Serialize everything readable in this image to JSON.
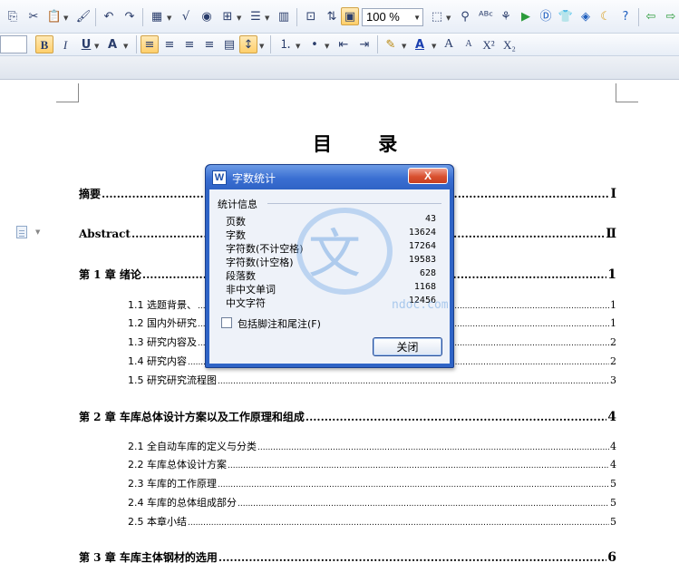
{
  "toolbar": {
    "zoom_value": "100 %",
    "row1_icons": [
      "copy-icon",
      "cut-icon",
      "paste-icon",
      "format-painter-icon",
      "undo-icon",
      "redo-icon",
      "table-icon",
      "formula-icon",
      "web-icon",
      "grid-icon",
      "columns-icon",
      "chart-icon",
      "insert-icon",
      "swap-icon",
      "page-view-icon",
      "select-icon",
      "find-icon",
      "spellcheck-icon",
      "share-icon",
      "play-icon",
      "d-icon",
      "shirt-icon",
      "chat-icon",
      "moon-icon",
      "help-icon",
      "back-icon",
      "forward-icon"
    ],
    "row2": {
      "bold": "B",
      "italic": "I",
      "underline": "U",
      "font_color_a": "A",
      "grow_font": "A",
      "shrink_font": "A",
      "superscript": "X²",
      "subscript": "X₂"
    }
  },
  "document": {
    "title": "目  录",
    "chapters": [
      {
        "label": "摘要",
        "page": "Ⅰ",
        "top": 0
      },
      {
        "label": "Abstract",
        "page": "Ⅱ"
      },
      {
        "label": "第 1 章  绪论",
        "page": "1"
      },
      {
        "label": "第 2 章  车库总体设计方案以及工作原理和组成",
        "page": "4"
      },
      {
        "label": "第 3 章  车库主体钢材的选用",
        "page": "6"
      }
    ],
    "sections": [
      {
        "label": "1.1  选题背景、",
        "page": "1"
      },
      {
        "label": "1.2  国内外研究",
        "page": "1"
      },
      {
        "label": "1.3  研究内容及",
        "page": "2"
      },
      {
        "label": "1.4  研究内容",
        "page": "2"
      },
      {
        "label": "1.5  研究研究流程图",
        "page": "3"
      },
      {
        "label": "2.1  全自动车库的定义与分类",
        "page": "4"
      },
      {
        "label": "2.2  车库总体设计方案",
        "page": "4"
      },
      {
        "label": "2.3  车库的工作原理",
        "page": "5"
      },
      {
        "label": "2.4  车库的总体组成部分",
        "page": "5"
      },
      {
        "label": "2.5  本章小结",
        "page": "5"
      }
    ]
  },
  "dialog": {
    "title": "字数统计",
    "close_glyph": "X",
    "group_label": "统计信息",
    "stats": [
      {
        "label": "页数",
        "value": "43"
      },
      {
        "label": "字数",
        "value": "13624"
      },
      {
        "label": "字符数(不计空格)",
        "value": "17264"
      },
      {
        "label": "字符数(计空格)",
        "value": "19583"
      },
      {
        "label": "段落数",
        "value": "628"
      },
      {
        "label": "非中文单词",
        "value": "1168"
      },
      {
        "label": "中文字符",
        "value": "12456"
      }
    ],
    "checkbox_label": "包括脚注和尾注(F)",
    "checkbox_checked": false,
    "ok_label": "关闭"
  },
  "watermark": {
    "text": "文",
    "url": "ndoc.com"
  },
  "colors": {
    "dialog_frame": "#2f64c6",
    "close_button": "#d9502f",
    "toolbar_bg": "#e8eef7"
  }
}
